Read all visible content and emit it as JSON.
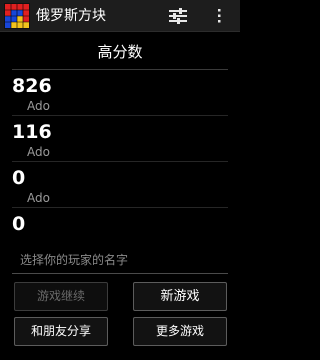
{
  "app": {
    "title": "俄罗斯方块"
  },
  "toolbar": {
    "settings_icon": "sliders-icon",
    "overflow_icon": "more-vertical-icon"
  },
  "high_scores": {
    "title": "高分数",
    "entries": [
      {
        "score": "826",
        "player": "Ado"
      },
      {
        "score": "116",
        "player": "Ado"
      },
      {
        "score": "0",
        "player": "Ado"
      },
      {
        "score": "0",
        "player": ""
      }
    ]
  },
  "player_name": {
    "value": "",
    "placeholder": "选择你的玩家的名字"
  },
  "buttons": {
    "continue_game": "游戏继续",
    "new_game": "新游戏",
    "share": "和朋友分享",
    "more_games": "更多游戏"
  },
  "colors": {
    "action_bar": "#1d1d1d",
    "background": "#000000",
    "secondary_text": "#9a9a9a",
    "disabled_text": "#6a6a6a",
    "icon_red": "#e02020",
    "icon_blue": "#1846d8",
    "icon_yellow": "#f2c31d"
  }
}
